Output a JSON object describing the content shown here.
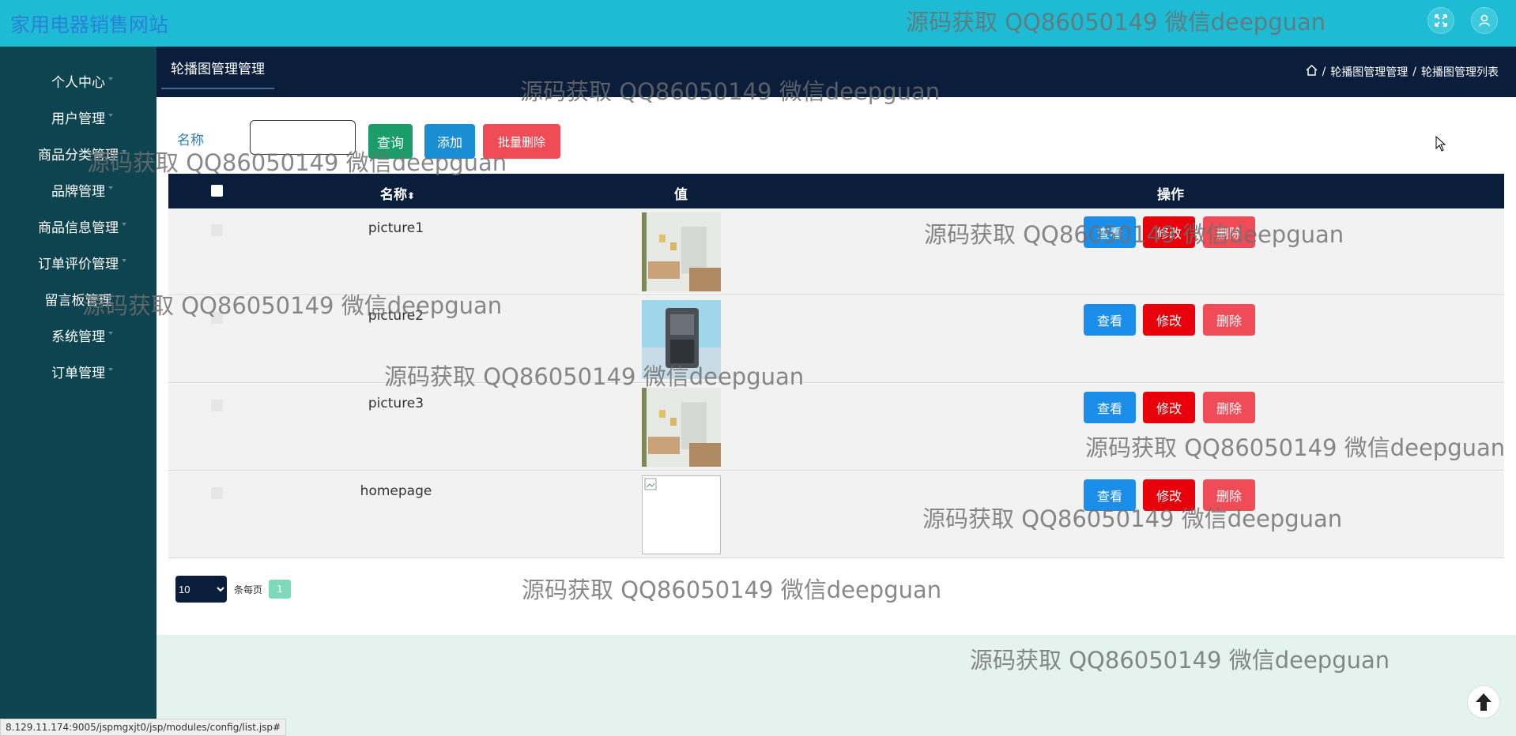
{
  "site_title": "家用电器销售网站",
  "sidebar": {
    "items": [
      {
        "label": "个人中心"
      },
      {
        "label": "用户管理"
      },
      {
        "label": "商品分类管理"
      },
      {
        "label": "品牌管理"
      },
      {
        "label": "商品信息管理"
      },
      {
        "label": "订单评价管理"
      },
      {
        "label": "留言板管理"
      },
      {
        "label": "系统管理"
      },
      {
        "label": "订单管理"
      }
    ]
  },
  "header": {
    "tab_title": "轮播图管理管理",
    "breadcrumb": [
      "轮播图管理管理",
      "轮播图管理列表"
    ],
    "separator": "/"
  },
  "search": {
    "label": "名称",
    "value": "",
    "query_label": "查询",
    "add_label": "添加",
    "bulk_delete_label": "批量删除"
  },
  "table": {
    "columns": [
      "名称",
      "值",
      "操作"
    ],
    "sort_glyph": "⬍",
    "rows": [
      {
        "name": "picture1",
        "image": "room"
      },
      {
        "name": "picture2",
        "image": "appliance"
      },
      {
        "name": "picture3",
        "image": "room"
      },
      {
        "name": "homepage",
        "image": "broken"
      }
    ],
    "actions": {
      "view": "查看",
      "edit": "修改",
      "delete": "删除"
    }
  },
  "pagination": {
    "page_size": "10",
    "page_size_options": [
      "10"
    ],
    "per_page_label": "条每页",
    "current_page": "1"
  },
  "status_url": "8.129.11.174:9005/jspmgxjt0/jsp/modules/config/list.jsp#",
  "watermark_text": "源码获取 QQ86050149 微信deepguan",
  "colors": {
    "topbar": "#1ebcd4",
    "sidebar": "#0e4450",
    "navy": "#0a1e3c",
    "primary": "#1a8ee8",
    "danger": "#e8000b",
    "success": "#1b9d6a"
  }
}
